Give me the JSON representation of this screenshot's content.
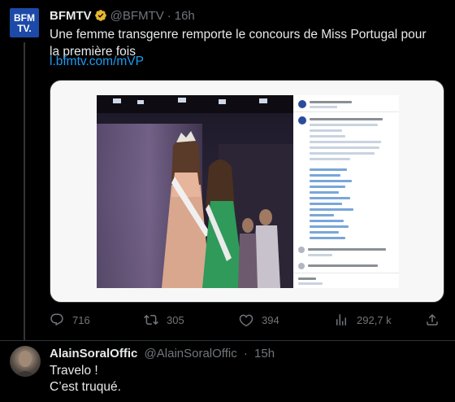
{
  "tweet": {
    "author_name": "BFMTV",
    "handle": "@BFMTV",
    "separator": "·",
    "time": "16h",
    "avatar_text_top": "BFM",
    "avatar_text_bottom": "TV.",
    "text": "Une femme transgenre remporte le concours de Miss Portugal pour la première fois",
    "link": "l.bfmtv.com/mVP",
    "stats": {
      "replies": "716",
      "retweets": "305",
      "likes": "394",
      "views": "292,7 k"
    },
    "icons": {
      "reply": "reply-icon",
      "retweet": "retweet-icon",
      "like": "heart-icon",
      "views": "views-icon",
      "share": "share-icon",
      "verified": "verified-badge-icon"
    },
    "colors": {
      "accent_link": "#1d9bf0",
      "verified_gold": "#e8b830",
      "bfm_blue": "#1d4aa8",
      "muted": "#71767b"
    }
  },
  "reply": {
    "author_name": "AlainSoralOffic",
    "handle": "@AlainSoralOffic",
    "separator": "·",
    "time": "15h",
    "line1": "Travelo !",
    "line2": "C’est truqué."
  }
}
